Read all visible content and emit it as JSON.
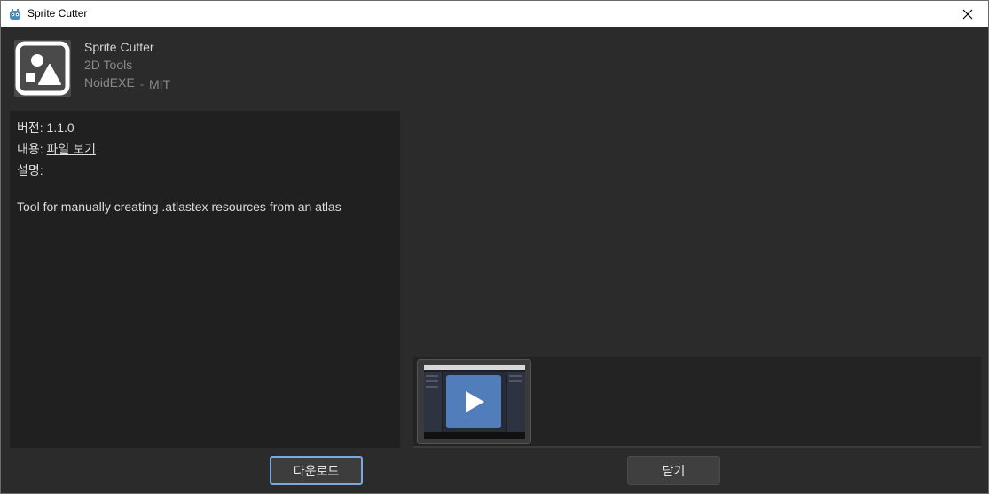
{
  "window": {
    "title": "Sprite Cutter"
  },
  "plugin": {
    "title": "Sprite Cutter",
    "category": "2D Tools",
    "author": "NoidEXE",
    "separator": "-",
    "license": "MIT",
    "icon": "sprite-shapes-icon"
  },
  "info": {
    "version_label": "버전:",
    "version_value": "1.1.0",
    "contents_label": "내용:",
    "contents_link": "파일 보기",
    "description_label": "설명:",
    "description": "Tool for manually creating .atlastex resources from an atlas"
  },
  "preview": {
    "thumbnail_icon": "play-icon"
  },
  "buttons": {
    "download": "다운로드",
    "close": "닫기"
  },
  "colors": {
    "background": "#2b2b2b",
    "panel": "#202020",
    "accent": "#7aa8e0"
  }
}
